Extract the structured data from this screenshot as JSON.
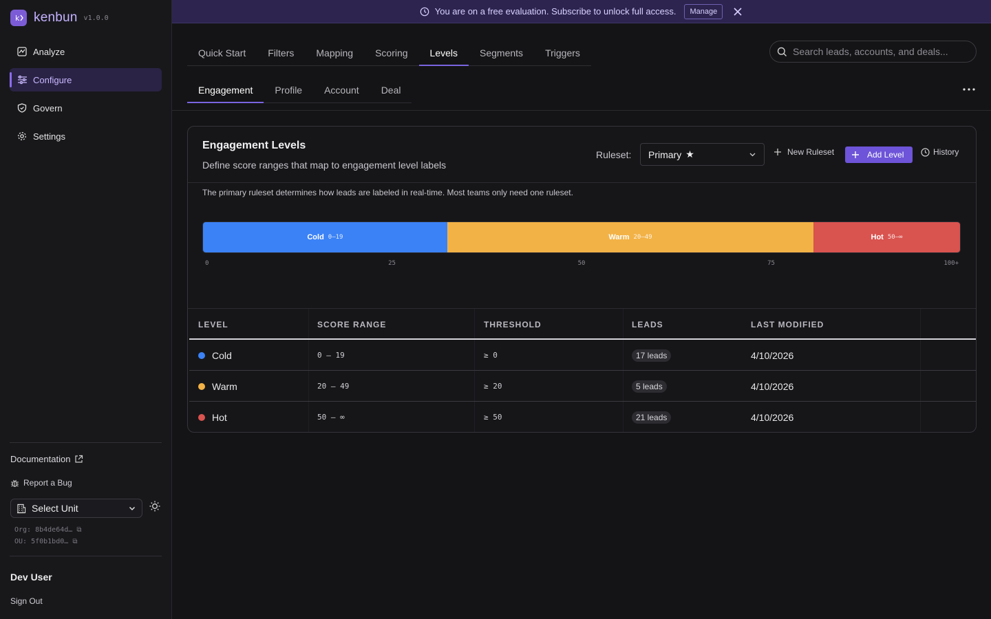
{
  "app": {
    "name": "kenbun",
    "version": "v1.0.0"
  },
  "sidebar": {
    "items": [
      {
        "label": "Analyze",
        "icon": "chart-icon"
      },
      {
        "label": "Configure",
        "icon": "sliders-icon",
        "active": true
      },
      {
        "label": "Govern",
        "icon": "shield-icon"
      },
      {
        "label": "Settings",
        "icon": "gear-icon"
      }
    ],
    "documentation": "Documentation",
    "report_bug": "Report a Bug",
    "unit_select": "Select Unit",
    "org_id": "Org: 8b4de64d…",
    "ou_id": "OU: 5f0b1bd0…",
    "user": "Dev User",
    "sign_out": "Sign Out"
  },
  "banner": {
    "text": "You are on a free evaluation. Subscribe to unlock full access.",
    "manage": "Manage"
  },
  "tabs": [
    "Quick Start",
    "Filters",
    "Mapping",
    "Scoring",
    "Levels",
    "Segments",
    "Triggers"
  ],
  "active_tab": "Levels",
  "subtabs": [
    "Engagement",
    "Profile",
    "Account",
    "Deal"
  ],
  "active_subtab": "Engagement",
  "search": {
    "placeholder": "Search leads, accounts, and deals..."
  },
  "card": {
    "title": "Engagement Levels",
    "subtitle": "Define score ranges that map to engagement level labels",
    "ruleset_label": "Ruleset:",
    "ruleset_value": "Primary",
    "new_ruleset": "New Ruleset",
    "add_level": "Add Level",
    "history": "History",
    "note": "The primary ruleset determines how leads are labeled in real-time. Most teams only need one ruleset."
  },
  "scale": {
    "max": 62,
    "segments": [
      {
        "name": "Cold",
        "range": "0–19",
        "from": 0,
        "to": 20,
        "color": "#3b82f6"
      },
      {
        "name": "Warm",
        "range": "20–49",
        "from": 20,
        "to": 50,
        "color": "#f2b246"
      },
      {
        "name": "Hot",
        "range": "50–∞",
        "from": 50,
        "to": 62,
        "color": "#d9534f"
      }
    ],
    "ticks": [
      "0",
      "25",
      "50",
      "75",
      "100+"
    ]
  },
  "table": {
    "headers": [
      "LEVEL",
      "SCORE RANGE",
      "THRESHOLD",
      "LEADS",
      "LAST MODIFIED"
    ],
    "rows": [
      {
        "level": "Cold",
        "color": "#3b82f6",
        "range": "0 — 19",
        "threshold": "≥ 0",
        "leads": "17 leads",
        "modified": "4/10/2026"
      },
      {
        "level": "Warm",
        "color": "#f2b246",
        "range": "20 — 49",
        "threshold": "≥ 20",
        "leads": "5 leads",
        "modified": "4/10/2026"
      },
      {
        "level": "Hot",
        "color": "#d9534f",
        "range": "50 — ∞",
        "threshold": "≥ 50",
        "leads": "21 leads",
        "modified": "4/10/2026"
      }
    ]
  }
}
